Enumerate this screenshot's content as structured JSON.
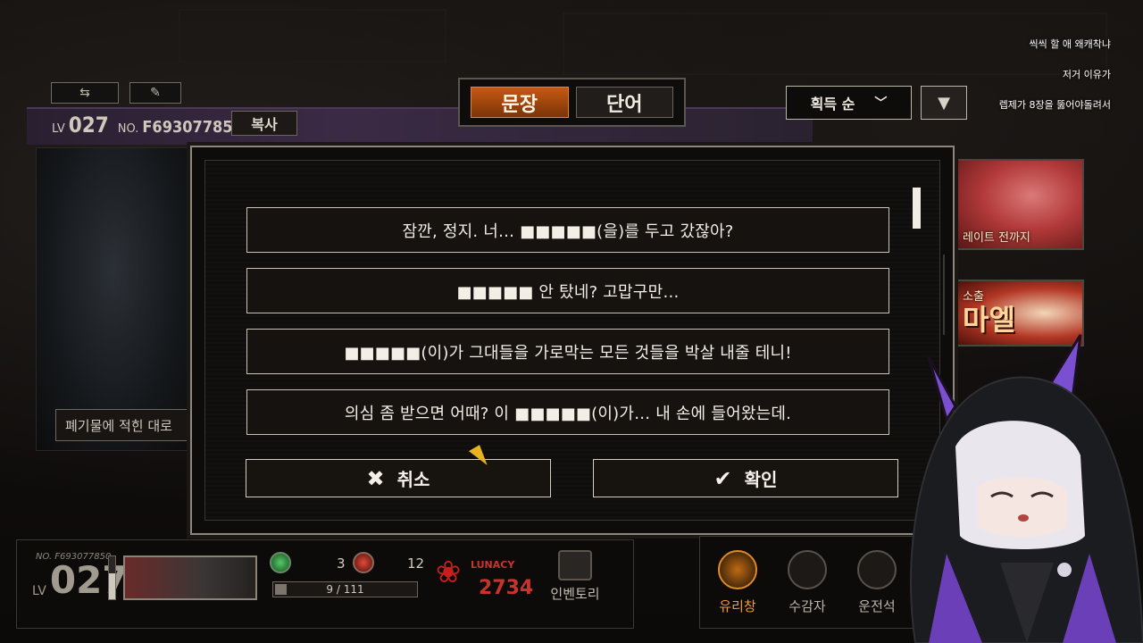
{
  "tabs": [
    {
      "label": "문장",
      "active": true
    },
    {
      "label": "단어",
      "active": false
    }
  ],
  "sort": {
    "label": "획득 순",
    "dropdown_icon": "chevron-down-icon",
    "direction_icon": "triangle-down-icon"
  },
  "card": {
    "lv_prefix": "LV",
    "level": "027",
    "no_prefix": "NO.",
    "number": "F693077850",
    "copy_label": "복사",
    "caption": "폐기물에 적힌 대로"
  },
  "thumbnails": [
    {
      "label": "레이트 전까지"
    },
    {
      "title": "마엘",
      "label": "소출"
    }
  ],
  "chat": [
    "씩씩 할 애 왜캐착냐",
    "저거 이유가",
    "렙제가 8장을 뚫어야돌려서"
  ],
  "modal": {
    "options": [
      "잠깐, 정지. 너… ■■■■■(을)를 두고 갔잖아?",
      "■■■■■ 안 탔네? 고맙구만…",
      "■■■■■(이)가 그대들을 가로막는 모든 것들을 박살 내줄 테니!",
      "의심 좀 받으면 어때? 이 ■■■■■(이)가… 내 손에 들어왔는데."
    ],
    "cancel_label": "취소",
    "confirm_label": "확인"
  },
  "bottom": {
    "no": "NO.  F693077850",
    "lv_prefix": "LV",
    "level": "027",
    "res1": "3",
    "res2": "12",
    "progress": "9 / 111",
    "progress_fraction": 0.081,
    "lunacy_label": "LUNACY",
    "lunacy_value": "2734",
    "inventory_label": "인벤토리"
  },
  "nav": [
    {
      "label": "유리창",
      "active": true
    },
    {
      "label": "수감자",
      "active": false
    },
    {
      "label": "운전석",
      "active": false
    }
  ],
  "colors": {
    "accent": "#e4852c",
    "lunacy": "#c8342c",
    "panel_border": "#c9c2b6"
  }
}
